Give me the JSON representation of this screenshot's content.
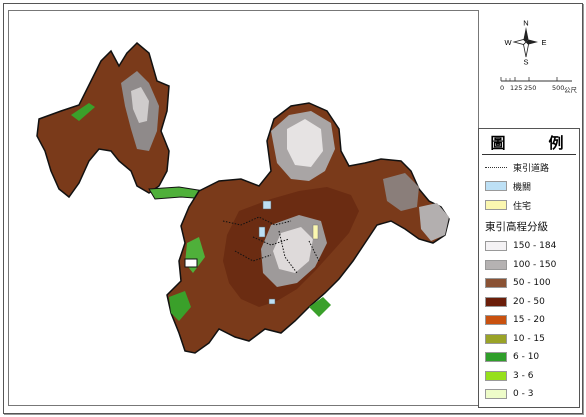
{
  "compass": {
    "n": "N",
    "s": "S",
    "e": "E",
    "w": "W"
  },
  "scale": {
    "ticks": [
      "0",
      "125",
      "250",
      "500"
    ],
    "unit": "公尺"
  },
  "legend": {
    "title": "圖　例",
    "road": "東引道路",
    "institution": "機關",
    "residence": "住宅",
    "elevation_title": "東引高程分級",
    "classes": [
      {
        "label": "150 - 184",
        "color": "#f4f2f4"
      },
      {
        "label": "100 - 150",
        "color": "#b5b2b2"
      },
      {
        "label": "50 - 100",
        "color": "#8a5234"
      },
      {
        "label": "20 - 50",
        "color": "#6b1e0a"
      },
      {
        "label": "15 - 20",
        "color": "#c9510f"
      },
      {
        "label": "10 - 15",
        "color": "#9aa327"
      },
      {
        "label": "6 - 10",
        "color": "#2f9e2a"
      },
      {
        "label": "3 - 6",
        "color": "#96e01c"
      },
      {
        "label": "0 - 3",
        "color": "#eefcc9"
      }
    ],
    "institution_color": "#bde0f5",
    "residence_color": "#fbf7b0"
  }
}
